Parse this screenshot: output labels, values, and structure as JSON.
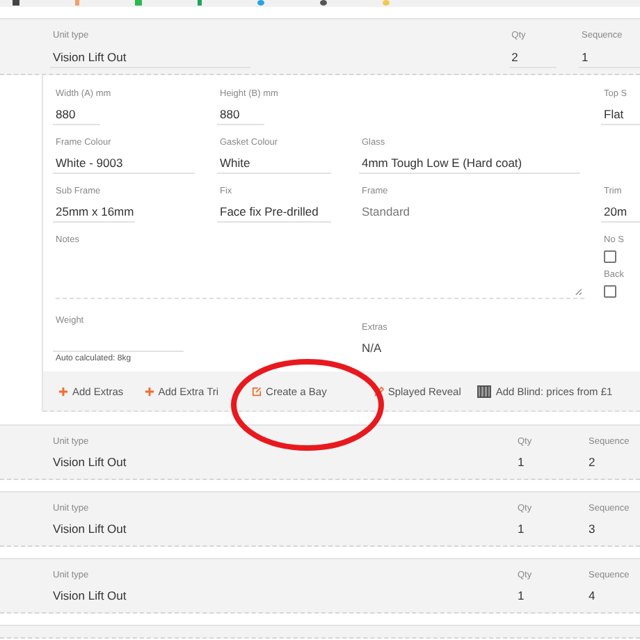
{
  "open_unit": {
    "unit_type_label": "Unit type",
    "unit_type": "Vision Lift Out",
    "qty_label": "Qty",
    "qty": "2",
    "sequence_label": "Sequence",
    "sequence": "1"
  },
  "details": {
    "width": {
      "label": "Width (A) mm",
      "value": "880"
    },
    "height": {
      "label": "Height (B) mm",
      "value": "880"
    },
    "top": {
      "label": "Top S",
      "value": "Flat"
    },
    "frame_colour": {
      "label": "Frame Colour",
      "value": "White - 9003"
    },
    "gasket_colour": {
      "label": "Gasket Colour",
      "value": "White"
    },
    "glass": {
      "label": "Glass",
      "value": "4mm Tough Low E (Hard coat)"
    },
    "sub_frame": {
      "label": "Sub Frame",
      "value": "25mm x 16mm"
    },
    "fix": {
      "label": "Fix",
      "value": "Face fix Pre-drilled"
    },
    "frame": {
      "label": "Frame",
      "value": "Standard"
    },
    "trim": {
      "label": "Trim",
      "value": "20m"
    },
    "notes": {
      "label": "Notes"
    },
    "no_s": {
      "label": "No S",
      "checked": false
    },
    "back": {
      "label": "Back",
      "checked": false
    },
    "weight": {
      "label": "Weight",
      "hint": "Auto calculated: 8kg"
    },
    "extras": {
      "label": "Extras",
      "value": "N/A"
    }
  },
  "actions": [
    {
      "label": "Add Extras",
      "kind": "plus"
    },
    {
      "label": "Add Extra Tri",
      "kind": "plus"
    },
    {
      "label": "Create a Bay",
      "kind": "edit"
    },
    {
      "label": "Splayed Reveal",
      "kind": "splay"
    },
    {
      "label": "Add Blind: prices from £1",
      "kind": "blind"
    }
  ],
  "units": [
    {
      "unit_type_label": "Unit type",
      "unit_type": "Vision Lift Out",
      "qty_label": "Qty",
      "qty": "1",
      "sequence_label": "Sequence",
      "sequence": "2"
    },
    {
      "unit_type_label": "Unit type",
      "unit_type": "Vision Lift Out",
      "qty_label": "Qty",
      "qty": "1",
      "sequence_label": "Sequence",
      "sequence": "3"
    },
    {
      "unit_type_label": "Unit type",
      "unit_type": "Vision Lift Out",
      "qty_label": "Qty",
      "qty": "1",
      "sequence_label": "Sequence",
      "sequence": "4"
    }
  ]
}
